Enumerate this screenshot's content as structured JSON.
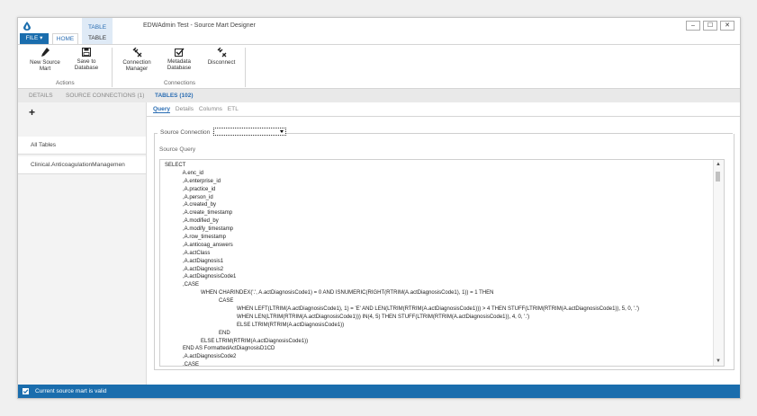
{
  "window": {
    "title": "EDWAdmin Test - Source Mart Designer"
  },
  "ribbon_tabs": {
    "file": "FILE",
    "file_arrow": "▾",
    "home": "HOME",
    "context_header": "TABLE",
    "table": "TABLE"
  },
  "window_buttons": {
    "minimize": "–",
    "maximize": "☐",
    "close": "✕"
  },
  "ribbon": {
    "actions_group": "Actions",
    "connections_group": "Connections",
    "new_source_mart": [
      "New Source",
      "Mart"
    ],
    "save_to_database": [
      "Save to",
      "Database"
    ],
    "connection_manager": [
      "Connection",
      "Manager"
    ],
    "metadata_database": [
      "Metadata",
      "Database"
    ],
    "disconnect": [
      "Disconnect"
    ]
  },
  "sub_tabs": {
    "details": "DETAILS",
    "source_connections": "SOURCE CONNECTIONS (1)",
    "tables": "TABLES (102)"
  },
  "left_panel": {
    "add_symbol": "+",
    "items": [
      "All Tables",
      "Clinical.AnticoagulationManagemen"
    ]
  },
  "query_tabs": {
    "query": "Query",
    "details": "Details",
    "columns": "Columns",
    "etl": "ETL"
  },
  "form": {
    "source_connection_label": "Source Connection",
    "source_connection_value": "",
    "source_query_label": "Source Query"
  },
  "scroll": {
    "up": "▲",
    "down": "▼"
  },
  "code_lines": [
    "SELECT",
    "            A.enc_id",
    "            ,A.enterprise_id",
    "            ,A.practice_id",
    "            ,A.person_id",
    "            ,A.created_by",
    "            ,A.create_timestamp",
    "            ,A.modified_by",
    "            ,A.modify_timestamp",
    "            ,A.row_timestamp",
    "            ,A.anticoag_answers",
    "            ,A.actClass",
    "            ,A.actDiagnosis1",
    "            ,A.actDiagnosis2",
    "            ,A.actDiagnosisCode1",
    "            ,CASE",
    "                        WHEN CHARINDEX('.', A.actDiagnosisCode1) = 0 AND ISNUMERIC(RIGHT(RTRIM(A.actDiagnosisCode1), 1)) = 1 THEN",
    "                                    CASE",
    "                                                WHEN LEFT(LTRIM(A.actDiagnosisCode1), 1) = 'E' AND LEN(LTRIM(RTRIM(A.actDiagnosisCode1))) > 4 THEN STUFF(LTRIM(RTRIM(A.actDiagnosisCode1)), 5, 0, '.')",
    "                                                WHEN LEN(LTRIM(RTRIM(A.actDiagnosisCode1))) IN(4, 5) THEN STUFF(LTRIM(RTRIM(A.actDiagnosisCode1)), 4, 0, '.')",
    "                                                ELSE LTRIM(RTRIM(A.actDiagnosisCode1))",
    "                                    END",
    "                        ELSE LTRIM(RTRIM(A.actDiagnosisCode1))",
    "            END AS FormattedActDiagnosisD1CD",
    "            ,A.actDiagnosisCode2",
    "            ,CASE"
  ],
  "status": {
    "text": "Current source mart is valid"
  },
  "colors": {
    "accent": "#1a6dad",
    "context_tab": "#dfeaf6",
    "link": "#2a6db3"
  }
}
